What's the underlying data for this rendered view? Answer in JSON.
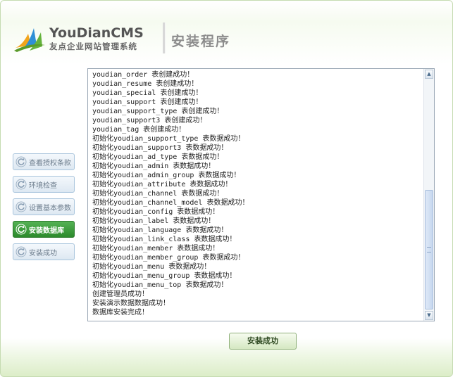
{
  "header": {
    "logo_brand": "YouDianCMS",
    "logo_subtitle": "友点企业网站管理系统",
    "title": "安装程序"
  },
  "steps": [
    {
      "label": "查看授权条款",
      "active": false
    },
    {
      "label": "环境检查",
      "active": false
    },
    {
      "label": "设置基本参数",
      "active": false
    },
    {
      "label": "安装数据库",
      "active": true
    },
    {
      "label": "安装成功",
      "active": false
    }
  ],
  "log": {
    "lines": [
      "youdian_order 表创建成功！",
      "youdian_resume 表创建成功！",
      "youdian_special 表创建成功！",
      "youdian_support 表创建成功！",
      "youdian_support_type 表创建成功！",
      "youdian_support3 表创建成功！",
      "youdian_tag 表创建成功！",
      "初始化youdian_support_type 表数据成功！",
      "初始化youdian_support3 表数据成功！",
      "初始化youdian_ad_type 表数据成功！",
      "初始化youdian_admin 表数据成功！",
      "初始化youdian_admin_group 表数据成功！",
      "初始化youdian_attribute 表数据成功！",
      "初始化youdian_channel 表数据成功！",
      "初始化youdian_channel_model 表数据成功！",
      "初始化youdian_config 表数据成功！",
      "初始化youdian_label 表数据成功！",
      "初始化youdian_language 表数据成功！",
      "初始化youdian_link_class 表数据成功！",
      "初始化youdian_member 表数据成功！",
      "初始化youdian_member_group 表数据成功！",
      "初始化youdian_menu 表数据成功！",
      "初始化youdian_menu_group 表数据成功！",
      "初始化youdian_menu_top 表数据成功！",
      "创建管理员成功！",
      "安装演示数据数据成功！",
      "数据库安装完成！"
    ]
  },
  "action_button": {
    "label": "安装成功"
  },
  "colors": {
    "accent_green": "#2b8a2b",
    "brand_orange": "#e08a1a",
    "step_border": "#a8c4dc"
  }
}
